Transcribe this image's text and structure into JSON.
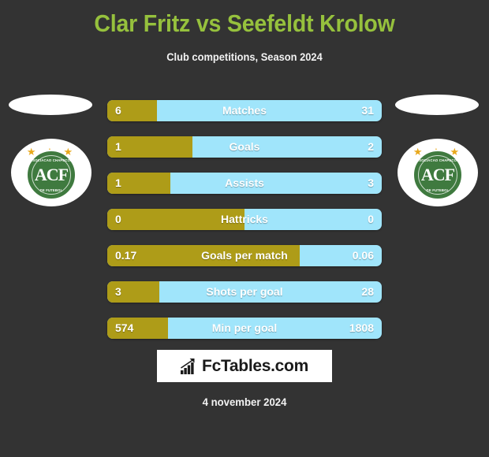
{
  "header": {
    "title": "Clar Fritz vs Seefeldt Krolow",
    "subtitle": "Club competitions, Season 2024",
    "title_color": "#96c13d"
  },
  "colors": {
    "background": "#333333",
    "home_bar": "#ae9c18",
    "away_bar": "#a0e5fb",
    "text": "#ffffff",
    "crest_green": "#3f7a3f",
    "star_gold": "#e8a81c"
  },
  "crests": {
    "left": {
      "name": "chapecoense-crest",
      "monogram": "ACF",
      "arc_top": "ASSOCIACAO CHAPECOENSE",
      "arc_bottom": "DE FUTEBOL",
      "stars": "★ ★ ★"
    },
    "right": {
      "name": "chapecoense-crest",
      "monogram": "ACF",
      "arc_top": "ASSOCIACAO CHAPECOENSE",
      "arc_bottom": "DE FUTEBOL",
      "stars": "★ ★ ★"
    }
  },
  "chart_data": {
    "type": "bar",
    "title": "Clar Fritz vs Seefeldt Krolow",
    "subtitle": "Club competitions, Season 2024",
    "series": [
      {
        "name": "Clar Fritz",
        "color": "#ae9c18"
      },
      {
        "name": "Seefeldt Krolow",
        "color": "#a0e5fb"
      }
    ],
    "categories": [
      "Matches",
      "Goals",
      "Assists",
      "Hattricks",
      "Goals per match",
      "Shots per goal",
      "Min per goal"
    ],
    "rows": [
      {
        "label": "Matches",
        "home": "6",
        "away": "31",
        "home_pct": 18
      },
      {
        "label": "Goals",
        "home": "1",
        "away": "2",
        "home_pct": 31
      },
      {
        "label": "Assists",
        "home": "1",
        "away": "3",
        "home_pct": 23
      },
      {
        "label": "Hattricks",
        "home": "0",
        "away": "0",
        "home_pct": 50
      },
      {
        "label": "Goals per match",
        "home": "0.17",
        "away": "0.06",
        "home_pct": 70
      },
      {
        "label": "Shots per goal",
        "home": "3",
        "away": "28",
        "home_pct": 19
      },
      {
        "label": "Min per goal",
        "home": "574",
        "away": "1808",
        "home_pct": 22
      }
    ]
  },
  "footer": {
    "brand": "FcTables.com",
    "brand_icon": "bar-chart-growth-icon",
    "date": "4 november 2024"
  }
}
